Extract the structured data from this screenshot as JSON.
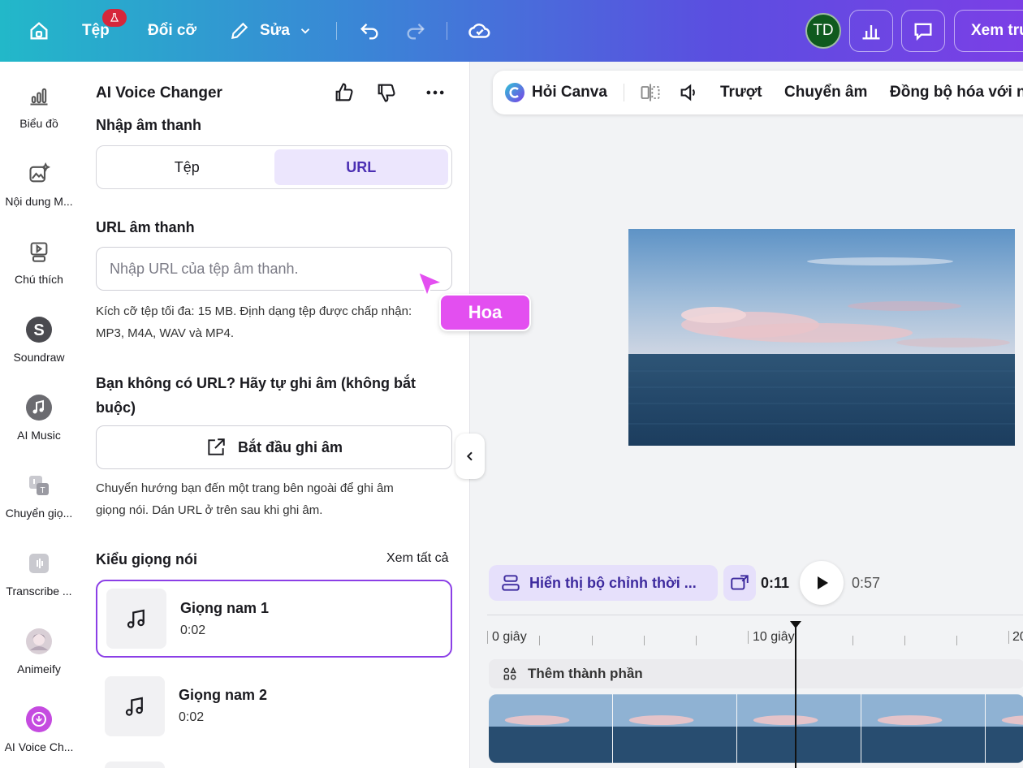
{
  "topbar": {
    "home_icon": "home-icon",
    "file_label": "Tệp",
    "badge_icon": "flask-icon",
    "resize_label": "Đổi cỡ",
    "edit_label": "Sửa",
    "avatar_initials": "TD",
    "share_label": "Xem trư"
  },
  "rail": {
    "items": [
      {
        "label": "Biểu đồ",
        "icon": "chart-icon"
      },
      {
        "label": "Nội dung M...",
        "icon": "magic-media-icon"
      },
      {
        "label": "Chú thích",
        "icon": "captions-icon"
      },
      {
        "label": "Soundraw",
        "icon": "soundraw-icon"
      },
      {
        "label": "AI Music",
        "icon": "music-app-icon"
      },
      {
        "label": "Chuyển giọ...",
        "icon": "voice-convert-icon"
      },
      {
        "label": "Transcribe ...",
        "icon": "transcribe-icon"
      },
      {
        "label": "Animeify",
        "icon": "animeify-icon"
      },
      {
        "label": "AI Voice Ch...",
        "icon": "ai-voice-changer-icon"
      }
    ]
  },
  "panel": {
    "title": "AI Voice Changer",
    "input_heading": "Nhập âm thanh",
    "tabs": [
      "Tệp",
      "URL"
    ],
    "active_tab": "URL",
    "url_heading": "URL âm thanh",
    "url_placeholder": "Nhập URL của tệp âm thanh.",
    "file_help_line1": "Kích cỡ tệp tối đa: 15 MB. Định dạng tệp được chấp nhận:",
    "file_help_line2": "MP3, M4A, WAV và MP4.",
    "record_heading_line1": "Bạn không có URL? Hãy tự ghi âm (không bắt",
    "record_heading_line2": "buộc)",
    "record_button": "Bắt đầu ghi âm",
    "record_help_line1": "Chuyển hướng bạn đến một trang bên ngoài để ghi âm",
    "record_help_line2": "giọng nói. Dán URL ở trên sau khi ghi âm.",
    "voice_heading": "Kiểu giọng nói",
    "see_all": "Xem tất cả",
    "voices": [
      {
        "name": "Giọng nam 1",
        "duration": "0:02"
      },
      {
        "name": "Giọng nam 2",
        "duration": "0:02"
      }
    ]
  },
  "canvas_toolbar": {
    "ask_canva": "Hỏi Canva",
    "slide": "Trượt",
    "transition": "Chuyển âm",
    "sync": "Đồng bộ hóa với n"
  },
  "timeline": {
    "show_timing": "Hiển thị bộ chỉnh thời ...",
    "current_time": "0:11",
    "total_time": "0:57",
    "tick_0": "0 giây",
    "tick_10": "10 giây",
    "tick_20": "20",
    "add_element": "Thêm thành phần"
  },
  "collaborator": {
    "name": "Hoa",
    "color": "#e34ff0"
  }
}
